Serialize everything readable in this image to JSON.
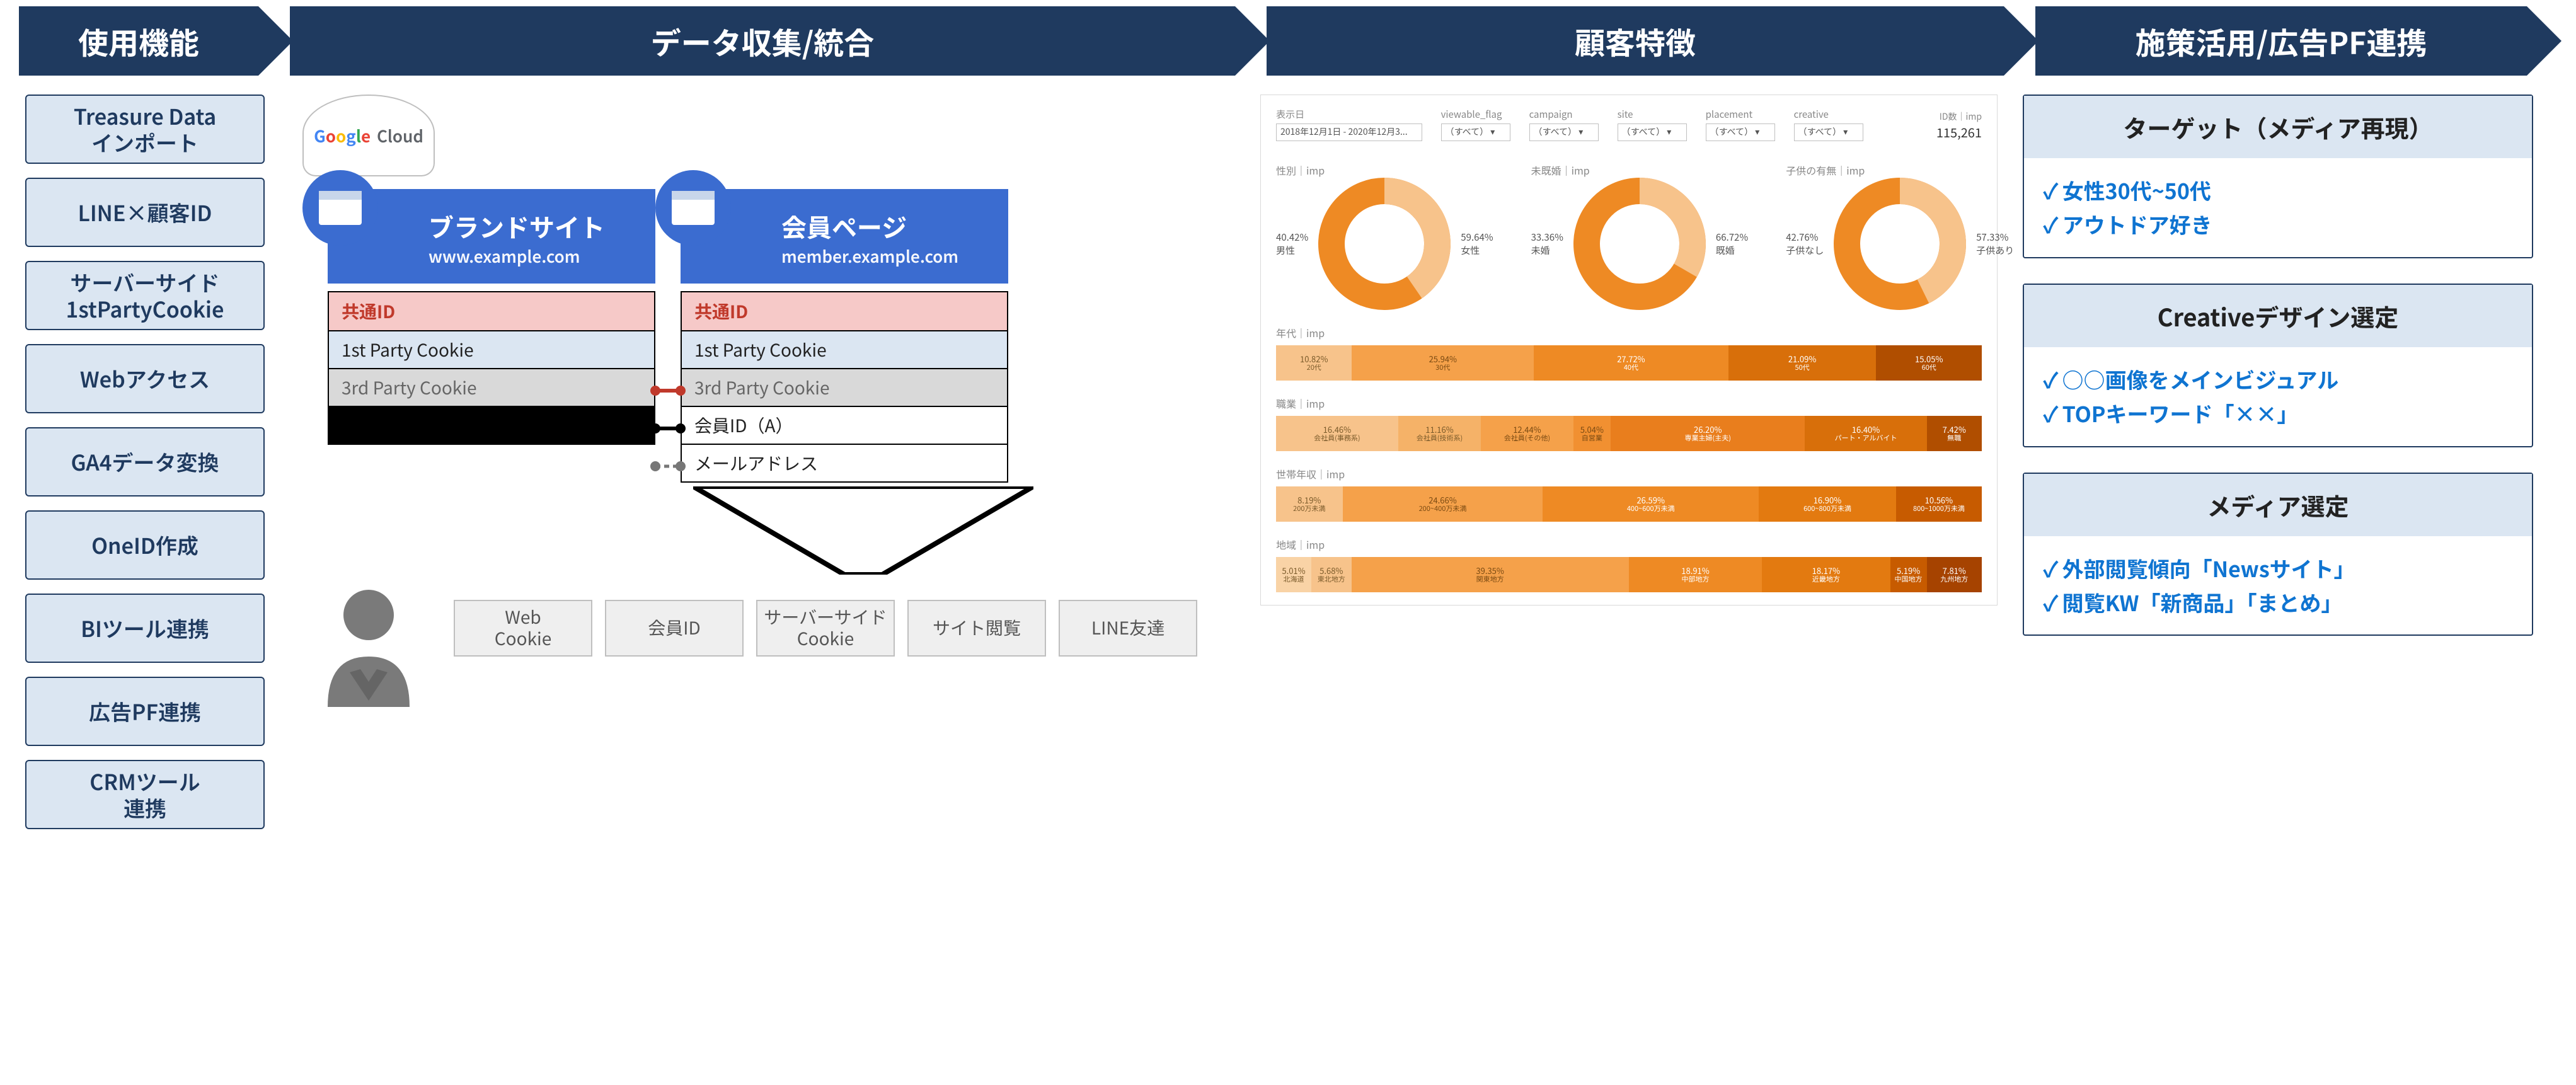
{
  "arrows": {
    "s1": "使用機能",
    "s2": "データ収集/統合",
    "s3": "顧客特徴",
    "s4": "施策活用/広告PF連携"
  },
  "funcs": [
    "Treasure Data\nインポート",
    "LINE×顧客ID",
    "サーバーサイド\n1stPartyCookie",
    "Webアクセス",
    "GA4データ変換",
    "OneID作成",
    "BIツール連携",
    "広告PF連携",
    "CRMツール\n連携"
  ],
  "cloud": {
    "g": "Google",
    "cloud": " Cloud"
  },
  "site1": {
    "title": "ブランドサイト",
    "url": "www.example.com",
    "rows": [
      {
        "k": "shared",
        "t": "共通ID"
      },
      {
        "k": "fpc",
        "t": "1st Party Cookie"
      },
      {
        "k": "tpc",
        "t": "3rd Party Cookie"
      },
      {
        "k": "blank",
        "t": ""
      }
    ]
  },
  "site2": {
    "title": "会員ページ",
    "url": "member.example.com",
    "rows": [
      {
        "k": "shared",
        "t": "共通ID"
      },
      {
        "k": "fpc",
        "t": "1st Party Cookie"
      },
      {
        "k": "tpc",
        "t": "3rd Party Cookie"
      },
      {
        "k": "member",
        "t": "会員ID（A）"
      },
      {
        "k": "email",
        "t": "メールアドレス"
      }
    ]
  },
  "bricks": [
    "Web\nCookie",
    "会員ID",
    "サーバーサイド\nCookie",
    "サイト閲覧",
    "LINE友達"
  ],
  "dash": {
    "daterange": "2018年12月1日 - 2020年12月3...",
    "filters": [
      {
        "label": "viewable_flag",
        "value": "（すべて）"
      },
      {
        "label": "campaign",
        "value": "（すべて）"
      },
      {
        "label": "site",
        "value": "（すべて）"
      },
      {
        "label": "placement",
        "value": "（すべて）"
      },
      {
        "label": "creative",
        "value": "（すべて）"
      }
    ],
    "imp_label": "ID数｜imp",
    "imp_total": "115,261"
  },
  "donuts": [
    {
      "head": "性別｜imp",
      "a": {
        "p": "40.42%",
        "l": "男性"
      },
      "b": {
        "p": "59.64%",
        "l": "女性"
      },
      "a_deg": 145.5
    },
    {
      "head": "未既婚｜imp",
      "a": {
        "p": "33.36%",
        "l": "未婚"
      },
      "b": {
        "p": "66.72%",
        "l": "既婚"
      },
      "a_deg": 120.1
    },
    {
      "head": "子供の有無｜imp",
      "a": {
        "p": "42.76%",
        "l": "子供なし"
      },
      "b": {
        "p": "57.33%",
        "l": "子供あり"
      },
      "a_deg": 153.9
    }
  ],
  "bars": [
    {
      "head": "年代｜imp",
      "segs": [
        {
          "p": "10.82%",
          "cat": "20代",
          "c": "#f7c38b",
          "ink": "#7a5a2a"
        },
        {
          "p": "25.94%",
          "cat": "30代",
          "c": "#f5a14a",
          "ink": "#7a4a12"
        },
        {
          "p": "27.72%",
          "cat": "40代",
          "c": "#ee8a24",
          "ink": "#fff"
        },
        {
          "p": "21.09%",
          "cat": "50代",
          "c": "#d86f0a",
          "ink": "#fff"
        },
        {
          "p": "15.05%",
          "cat": "60代",
          "c": "#b04e00",
          "ink": "#fff"
        }
      ]
    },
    {
      "head": "職業｜imp",
      "segs": [
        {
          "p": "16.46%",
          "cat": "会社員(事務系)",
          "c": "#f7c38b",
          "ink": "#7a5a2a"
        },
        {
          "p": "11.16%",
          "cat": "会社員(技術系)",
          "c": "#f5b268",
          "ink": "#7a5a2a"
        },
        {
          "p": "12.44%",
          "cat": "会社員(その他)",
          "c": "#f5a14a",
          "ink": "#7a4a12"
        },
        {
          "p": "5.04%",
          "cat": "自営業",
          "c": "#f19031",
          "ink": "#7a4a12"
        },
        {
          "p": "26.20%",
          "cat": "専業主婦(主夫)",
          "c": "#e97e1d",
          "ink": "#fff"
        },
        {
          "p": "16.40%",
          "cat": "パート・アルバイト",
          "c": "#d86f0a",
          "ink": "#fff"
        },
        {
          "p": "7.42%",
          "cat": "無職",
          "c": "#b04e00",
          "ink": "#fff"
        }
      ]
    },
    {
      "head": "世帯年収｜imp",
      "segs": [
        {
          "p": "8.19%",
          "cat": "200万未満",
          "c": "#f7c38b",
          "ink": "#7a5a2a"
        },
        {
          "p": "24.66%",
          "cat": "200~400万未満",
          "c": "#f5a14a",
          "ink": "#7a4a12"
        },
        {
          "p": "26.59%",
          "cat": "400~600万未満",
          "c": "#ee8a24",
          "ink": "#fff"
        },
        {
          "p": "16.90%",
          "cat": "600~800万未満",
          "c": "#e37a10",
          "ink": "#fff"
        },
        {
          "p": "10.56%",
          "cat": "800~1000万未満",
          "c": "#c75b00",
          "ink": "#fff"
        }
      ]
    },
    {
      "head": "地域｜imp",
      "segs": [
        {
          "p": "5.01%",
          "cat": "北海道",
          "c": "#f9d3a6",
          "ink": "#7a5a2a"
        },
        {
          "p": "5.68%",
          "cat": "東北地方",
          "c": "#f7c38b",
          "ink": "#7a5a2a"
        },
        {
          "p": "39.35%",
          "cat": "関東地方",
          "c": "#f5a14a",
          "ink": "#7a4a12"
        },
        {
          "p": "18.91%",
          "cat": "中部地方",
          "c": "#ee8a24",
          "ink": "#fff"
        },
        {
          "p": "18.17%",
          "cat": "近畿地方",
          "c": "#e37a10",
          "ink": "#fff"
        },
        {
          "p": "5.19%",
          "cat": "中国地方",
          "c": "#c75b00",
          "ink": "#fff"
        },
        {
          "p": "7.81%",
          "cat": "九州地方",
          "c": "#a64300",
          "ink": "#fff"
        }
      ]
    }
  ],
  "cards": [
    {
      "head": "ターゲット（メディア再現）",
      "items": [
        "女性30代~50代",
        "アウトドア好き"
      ]
    },
    {
      "head": "Creativeデザイン選定",
      "items": [
        "○○画像をメインビジュアル",
        "TOPキーワード「××」"
      ]
    },
    {
      "head": "メディア選定",
      "items": [
        "外部閲覧傾向「Newsサイト」",
        "閲覧KW「新商品」「まとめ」"
      ]
    }
  ],
  "chart_data": {
    "donuts": [
      {
        "title": "性別｜imp",
        "type": "pie",
        "slices": [
          {
            "label": "男性",
            "pct": 40.42
          },
          {
            "label": "女性",
            "pct": 59.64
          }
        ]
      },
      {
        "title": "未既婚｜imp",
        "type": "pie",
        "slices": [
          {
            "label": "未婚",
            "pct": 33.36
          },
          {
            "label": "既婚",
            "pct": 66.72
          }
        ]
      },
      {
        "title": "子供の有無｜imp",
        "type": "pie",
        "slices": [
          {
            "label": "子供なし",
            "pct": 42.76
          },
          {
            "label": "子供あり",
            "pct": 57.33
          }
        ]
      }
    ],
    "stacked_bars": [
      {
        "title": "年代｜imp",
        "type": "bar",
        "categories": [
          "20代",
          "30代",
          "40代",
          "50代",
          "60代"
        ],
        "values": [
          10.82,
          25.94,
          27.72,
          21.09,
          15.05
        ]
      },
      {
        "title": "職業｜imp",
        "type": "bar",
        "categories": [
          "会社員(事務系)",
          "会社員(技術系)",
          "会社員(その他)",
          "自営業",
          "専業主婦(主夫)",
          "パート・アルバイト",
          "無職"
        ],
        "values": [
          16.46,
          11.16,
          12.44,
          5.04,
          26.2,
          16.4,
          7.42
        ]
      },
      {
        "title": "世帯年収｜imp",
        "type": "bar",
        "categories": [
          "200万未満",
          "200~400万未満",
          "400~600万未満",
          "600~800万未満",
          "800~1000万未満"
        ],
        "values": [
          8.19,
          24.66,
          26.59,
          16.9,
          10.56
        ]
      },
      {
        "title": "地域｜imp",
        "type": "bar",
        "categories": [
          "北海道",
          "東北地方",
          "関東地方",
          "中部地方",
          "近畿地方",
          "中国地方",
          "九州地方"
        ],
        "values": [
          5.01,
          5.68,
          39.35,
          18.91,
          18.17,
          5.19,
          7.81
        ]
      }
    ]
  }
}
